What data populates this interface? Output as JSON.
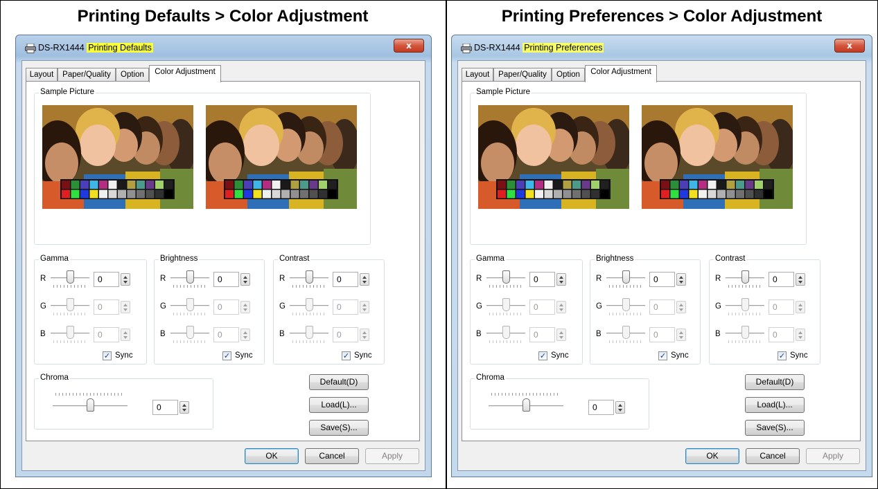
{
  "headings": {
    "left": "Printing Defaults > Color Adjustment",
    "right": "Printing Preferences > Color Adjustment"
  },
  "left_window": {
    "title_prefix": "DS-RX1444 ",
    "title_highlight": "Printing Defaults",
    "close_label": "x"
  },
  "right_window": {
    "title_prefix": "DS-RX1444 ",
    "title_highlight": "Printing Preferences",
    "close_label": "x"
  },
  "tabs": [
    "Layout",
    "Paper/Quality",
    "Option",
    "Color Adjustment"
  ],
  "active_tab": "Color Adjustment",
  "sample_picture_label": "Sample Picture",
  "groups": {
    "gamma": "Gamma",
    "brightness": "Brightness",
    "contrast": "Contrast",
    "chroma": "Chroma"
  },
  "channels": [
    "R",
    "G",
    "B"
  ],
  "values": {
    "gamma": {
      "R": "0",
      "G": "0",
      "B": "0"
    },
    "brightness": {
      "R": "0",
      "G": "0",
      "B": "0"
    },
    "contrast": {
      "R": "0",
      "G": "0",
      "B": "0"
    },
    "chroma": "0"
  },
  "sync": {
    "label": "Sync",
    "checked": true
  },
  "buttons": {
    "default": "Default(D)",
    "load": "Load(L)...",
    "save": "Save(S)...",
    "ok": "OK",
    "cancel": "Cancel",
    "apply": "Apply"
  },
  "colors": {
    "highlight": "#f8ff3a",
    "title_bar": "#9fbfe0",
    "close_button": "#c23a22"
  },
  "icons": {
    "title": "printer-icon",
    "checkbox": "checkmark-icon"
  },
  "levels": {
    "chroma_slider_fraction": 0.5,
    "gamma_slider_fraction": 0.5,
    "brightness_slider_fraction": 0.5,
    "contrast_slider_fraction": 0.5
  }
}
